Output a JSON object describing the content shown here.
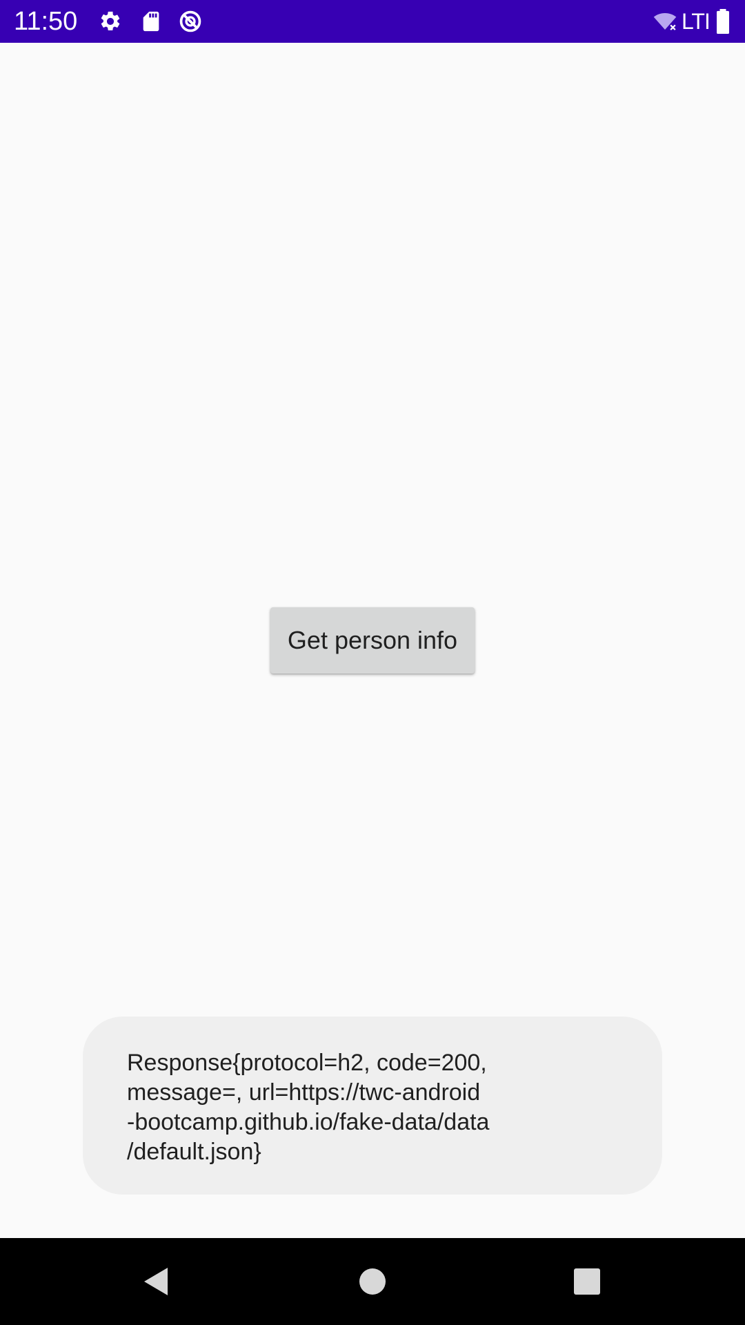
{
  "status_bar": {
    "time": "11:50",
    "network_label": "LTI",
    "background_color": "#3700b3",
    "icons": [
      "gear-icon",
      "sd-card-icon",
      "do-not-disturb-icon",
      "wifi-off-icon",
      "battery-icon"
    ]
  },
  "main": {
    "button_label": "Get person info"
  },
  "toast": {
    "lines": [
      "Response{protocol=h2, code=200,",
      "message=, url=https://twc-android",
      "-bootcamp.github.io/fake-data/data",
      "/default.json}"
    ]
  },
  "nav_bar": {
    "buttons": [
      "back-icon",
      "home-icon",
      "recents-icon"
    ]
  }
}
